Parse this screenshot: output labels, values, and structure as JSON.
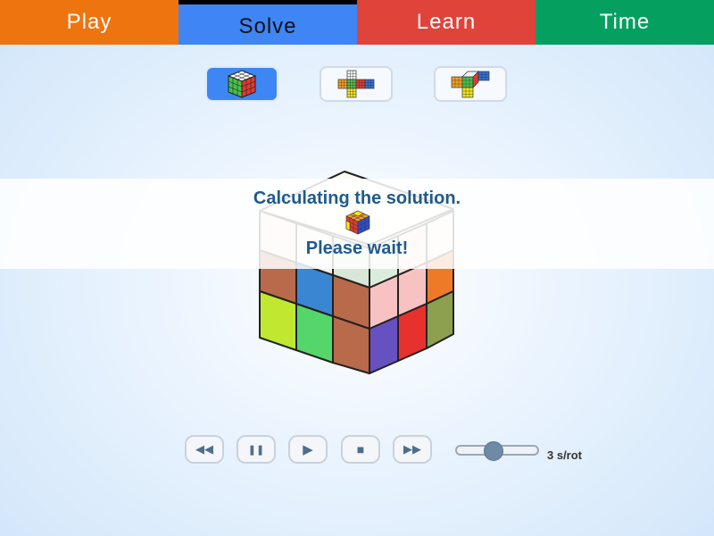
{
  "tabs": [
    {
      "label": "Play",
      "color": "#ee7410"
    },
    {
      "label": "Solve",
      "color": "#3f85f4",
      "active": true
    },
    {
      "label": "Learn",
      "color": "#e0433a"
    },
    {
      "label": "Time",
      "color": "#05a060"
    }
  ],
  "view_buttons": [
    {
      "name": "cube-3d-view-icon",
      "active": true
    },
    {
      "name": "cube-cross-net-icon",
      "active": false
    },
    {
      "name": "cube-unfolded-3d-icon",
      "active": false
    }
  ],
  "overlay": {
    "line1": "Calculating the solution.",
    "line2": "Please wait!"
  },
  "controls": {
    "rewind_icon": "◀◀",
    "pause_icon": "❚❚",
    "play_icon": "▶",
    "stop_icon": "■",
    "forward_icon": "▶▶",
    "speed_label": "3 s/rot",
    "speed_value": 3
  },
  "colors": {
    "accent": "#3f85f4",
    "message_text": "#1f5a8c"
  }
}
